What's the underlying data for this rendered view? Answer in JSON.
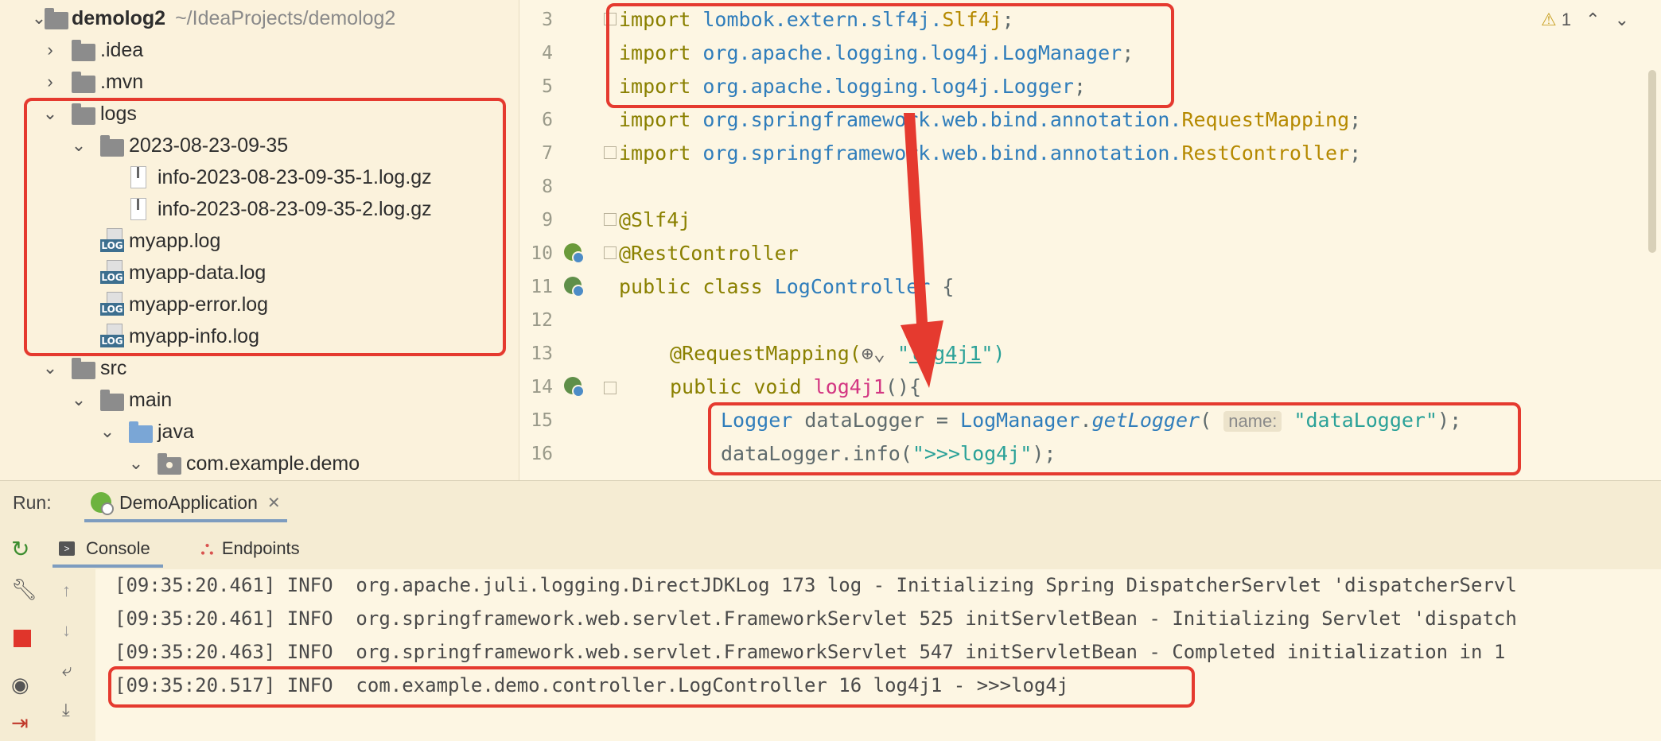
{
  "project_tree": {
    "root": {
      "name": "demolog2",
      "path": "~/IdeaProjects/demolog2"
    },
    "items": [
      {
        "label": ".idea"
      },
      {
        "label": ".mvn"
      },
      {
        "label": "logs"
      },
      {
        "label": "2023-08-23-09-35"
      },
      {
        "label": "info-2023-08-23-09-35-1.log.gz"
      },
      {
        "label": "info-2023-08-23-09-35-2.log.gz"
      },
      {
        "label": "myapp.log"
      },
      {
        "label": "myapp-data.log"
      },
      {
        "label": "myapp-error.log"
      },
      {
        "label": "myapp-info.log"
      },
      {
        "label": "src"
      },
      {
        "label": "main"
      },
      {
        "label": "java"
      },
      {
        "label": "com.example.demo"
      }
    ]
  },
  "editor": {
    "line_numbers": [
      "3",
      "4",
      "5",
      "6",
      "7",
      "8",
      "9",
      "10",
      "11",
      "12",
      "13",
      "14",
      "15",
      "16"
    ],
    "warnings_count": "1",
    "lines": {
      "l3": {
        "kw": "import",
        "pkg": "lombok.extern.slf4j.",
        "cls": "Slf4j",
        "end": ";"
      },
      "l4": {
        "kw": "import",
        "pkg": "org.apache.logging.log4j.",
        "cls": "LogManager",
        "end": ";"
      },
      "l5": {
        "kw": "import",
        "pkg": "org.apache.logging.log4j.",
        "cls": "Logger",
        "end": ";"
      },
      "l6": {
        "kw": "import",
        "pkg": "org.springframework.web.bind.annotation.",
        "cls": "RequestMapping",
        "end": ";"
      },
      "l7": {
        "kw": "import",
        "pkg": "org.springframework.web.bind.annotation.",
        "cls": "RestController",
        "end": ";"
      },
      "l9": {
        "ann": "@Slf4j"
      },
      "l10": {
        "ann": "@RestController"
      },
      "l11": {
        "kw": "public class",
        "cls": "LogController",
        "end": " {"
      },
      "l13": {
        "ann": "@RequestMapping(",
        "link": "log4j1",
        "end": "\")"
      },
      "l14": {
        "kw": "public void",
        "fn": "log4j1",
        "end": "(){"
      },
      "l15": {
        "type": "Logger",
        "var": " dataLogger = ",
        "cls": "LogManager",
        "dot": ".",
        "method": "getLogger",
        "paren": "(",
        "hint": "name:",
        "str": "\"dataLogger\"",
        "end": ");"
      },
      "l16": {
        "var": "dataLogger.info(",
        "str": "\">>>log4j\"",
        "end": ");"
      }
    }
  },
  "run_panel": {
    "label": "Run:",
    "tab": "DemoApplication",
    "subtabs": {
      "console": "Console",
      "endpoints": "Endpoints"
    },
    "console_lines": [
      "[09:35:20.461] INFO  org.apache.juli.logging.DirectJDKLog 173 log - Initializing Spring DispatcherServlet 'dispatcherServl",
      "[09:35:20.461] INFO  org.springframework.web.servlet.FrameworkServlet 525 initServletBean - Initializing Servlet 'dispatch",
      "[09:35:20.463] INFO  org.springframework.web.servlet.FrameworkServlet 547 initServletBean - Completed initialization in 1",
      "[09:35:20.517] INFO  com.example.demo.controller.LogController 16 log4j1 - >>>log4j"
    ]
  },
  "colors": {
    "annotation_red": "#e53a2f",
    "background": "#fdf6e3"
  }
}
